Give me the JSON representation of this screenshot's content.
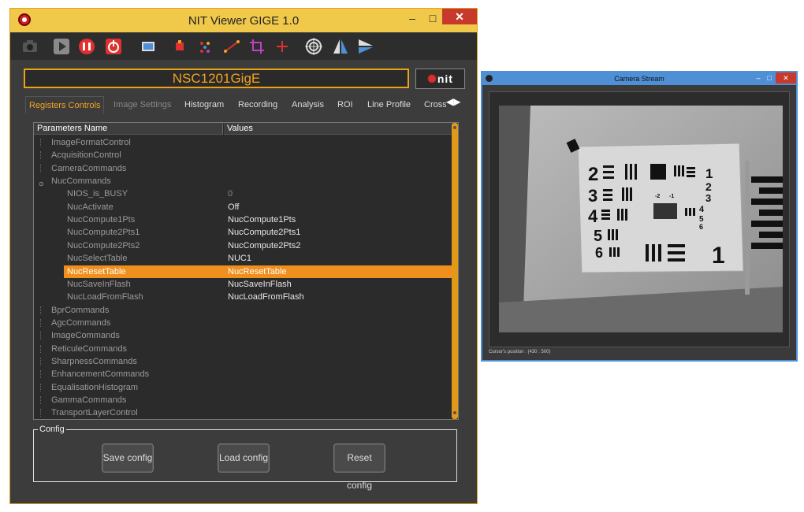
{
  "main_window": {
    "title": "NIT Viewer GIGE 1.0",
    "controls": {
      "minimize": "–",
      "maximize": "□",
      "close": "✕"
    },
    "device_name": "NSC1201GigE",
    "logo_text": "nit",
    "toolbar_icons": [
      "camera-icon",
      "play-icon",
      "pause-icon",
      "power-icon",
      "image-icon",
      "crosshair-small-icon",
      "dots-icon",
      "line-icon",
      "crop-icon",
      "cross-icon",
      "target-icon",
      "mirror-vertical-icon",
      "mirror-horizontal-icon"
    ],
    "tabs": [
      {
        "label": "Registers Controls",
        "active": true
      },
      {
        "label": "Image Settings",
        "active": false
      },
      {
        "label": "Histogram",
        "active": false
      },
      {
        "label": "Recording",
        "active": false
      },
      {
        "label": "Analysis",
        "active": false
      },
      {
        "label": "ROI",
        "active": false
      },
      {
        "label": "Line Profile",
        "active": false
      },
      {
        "label": "Cross",
        "active": false
      }
    ],
    "table": {
      "headers": [
        "Parameters Name",
        "Values"
      ],
      "rows": [
        {
          "name": "ImageFormatControl",
          "value": "",
          "level": 0,
          "expanded": false
        },
        {
          "name": "AcquisitionControl",
          "value": "",
          "level": 0,
          "expanded": false
        },
        {
          "name": "CameraCommands",
          "value": "",
          "level": 0,
          "expanded": false
        },
        {
          "name": "NucCommands",
          "value": "",
          "level": 0,
          "expanded": true
        },
        {
          "name": "NIOS_is_BUSY",
          "value": "0",
          "level": 1
        },
        {
          "name": "NucActivate",
          "value": "Off",
          "level": 1
        },
        {
          "name": "NucCompute1Pts",
          "value": "NucCompute1Pts",
          "level": 1
        },
        {
          "name": "NucCompute2Pts1",
          "value": "NucCompute2Pts1",
          "level": 1
        },
        {
          "name": "NucCompute2Pts2",
          "value": "NucCompute2Pts2",
          "level": 1
        },
        {
          "name": "NucSelectTable",
          "value": "NUC1",
          "level": 1
        },
        {
          "name": "NucResetTable",
          "value": "NucResetTable",
          "level": 1,
          "selected": true
        },
        {
          "name": "NucSaveInFlash",
          "value": "NucSaveInFlash",
          "level": 1
        },
        {
          "name": "NucLoadFromFlash",
          "value": "NucLoadFromFlash",
          "level": 1
        },
        {
          "name": "BprCommands",
          "value": "",
          "level": 0,
          "expanded": false
        },
        {
          "name": "AgcCommands",
          "value": "",
          "level": 0,
          "expanded": false
        },
        {
          "name": "ImageCommands",
          "value": "",
          "level": 0,
          "expanded": false
        },
        {
          "name": "ReticuleCommands",
          "value": "",
          "level": 0,
          "expanded": false
        },
        {
          "name": "SharpnessCommands",
          "value": "",
          "level": 0,
          "expanded": false
        },
        {
          "name": "EnhancementCommands",
          "value": "",
          "level": 0,
          "expanded": false
        },
        {
          "name": "EqualisationHistogram",
          "value": "",
          "level": 0,
          "expanded": false
        },
        {
          "name": "GammaCommands",
          "value": "",
          "level": 0,
          "expanded": false
        },
        {
          "name": "TransportLayerControl",
          "value": "",
          "level": 0,
          "expanded": false
        }
      ]
    },
    "config": {
      "label": "Config",
      "save": "Save config",
      "load": "Load config",
      "reset": "Reset config"
    }
  },
  "stream_window": {
    "title": "Camera Stream",
    "cursor_position": "Cursor's position : (430 : 500)",
    "target_numbers": [
      "2",
      "3",
      "4",
      "5",
      "6",
      "1",
      "2",
      "3",
      "4",
      "5",
      "6",
      "-2",
      "-1",
      "1"
    ]
  },
  "colors": {
    "accent": "#f2a31e",
    "titlebar": "#f0c84a",
    "selection": "#ef8f1d",
    "stream_border": "#4e8fd6"
  }
}
